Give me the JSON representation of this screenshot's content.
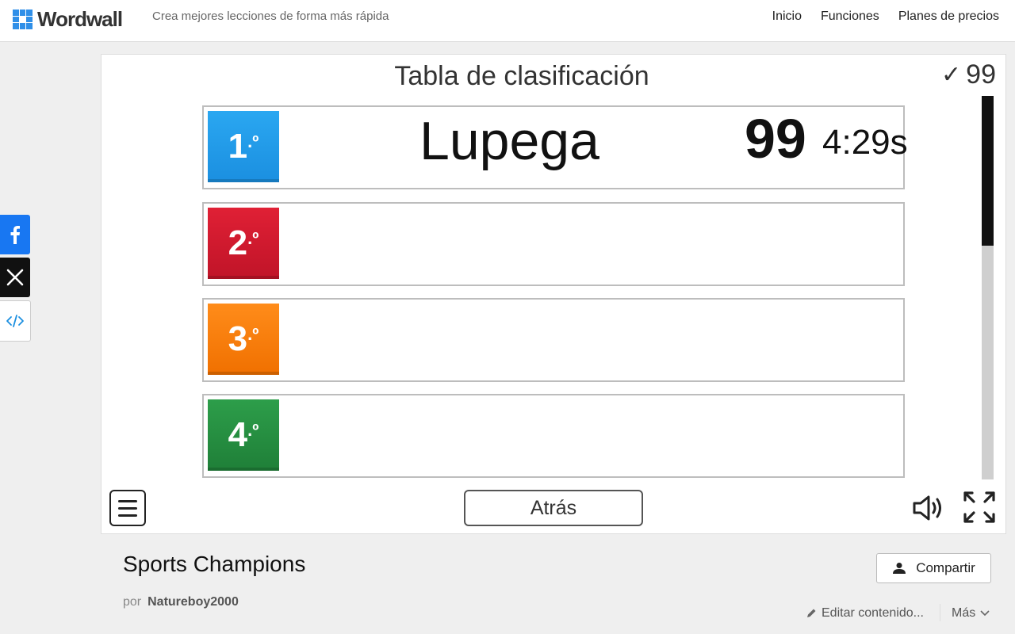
{
  "header": {
    "logo_text": "Wordwall",
    "tagline": "Crea mejores lecciones de forma más rápida",
    "nav": [
      "Inicio",
      "Funciones",
      "Planes de precios"
    ]
  },
  "share": {
    "facebook_icon": "facebook-icon",
    "x_icon": "x-icon",
    "embed_icon": "embed-icon"
  },
  "leaderboard": {
    "title": "Tabla de clasificación",
    "score_check": "✓",
    "score_total": "99",
    "progress_fraction": 0.39,
    "rows": [
      {
        "rank": "1",
        "suffix": ".º",
        "name": "Lupega",
        "score": "99",
        "time": "4:29s",
        "color": "#2196f3"
      },
      {
        "rank": "2",
        "suffix": ".º",
        "name": "",
        "score": "",
        "time": "",
        "color": "#d91a2e"
      },
      {
        "rank": "3",
        "suffix": ".º",
        "name": "",
        "score": "",
        "time": "",
        "color": "#f77f00"
      },
      {
        "rank": "4",
        "suffix": ".º",
        "name": "",
        "score": "",
        "time": "",
        "color": "#26903f"
      }
    ],
    "back_label": "Atrás"
  },
  "activity": {
    "title": "Sports Champions",
    "by_label": "por",
    "author": "Natureboy2000",
    "share_label": "Compartir",
    "edit_label": "Editar contenido...",
    "more_label": "Más"
  }
}
